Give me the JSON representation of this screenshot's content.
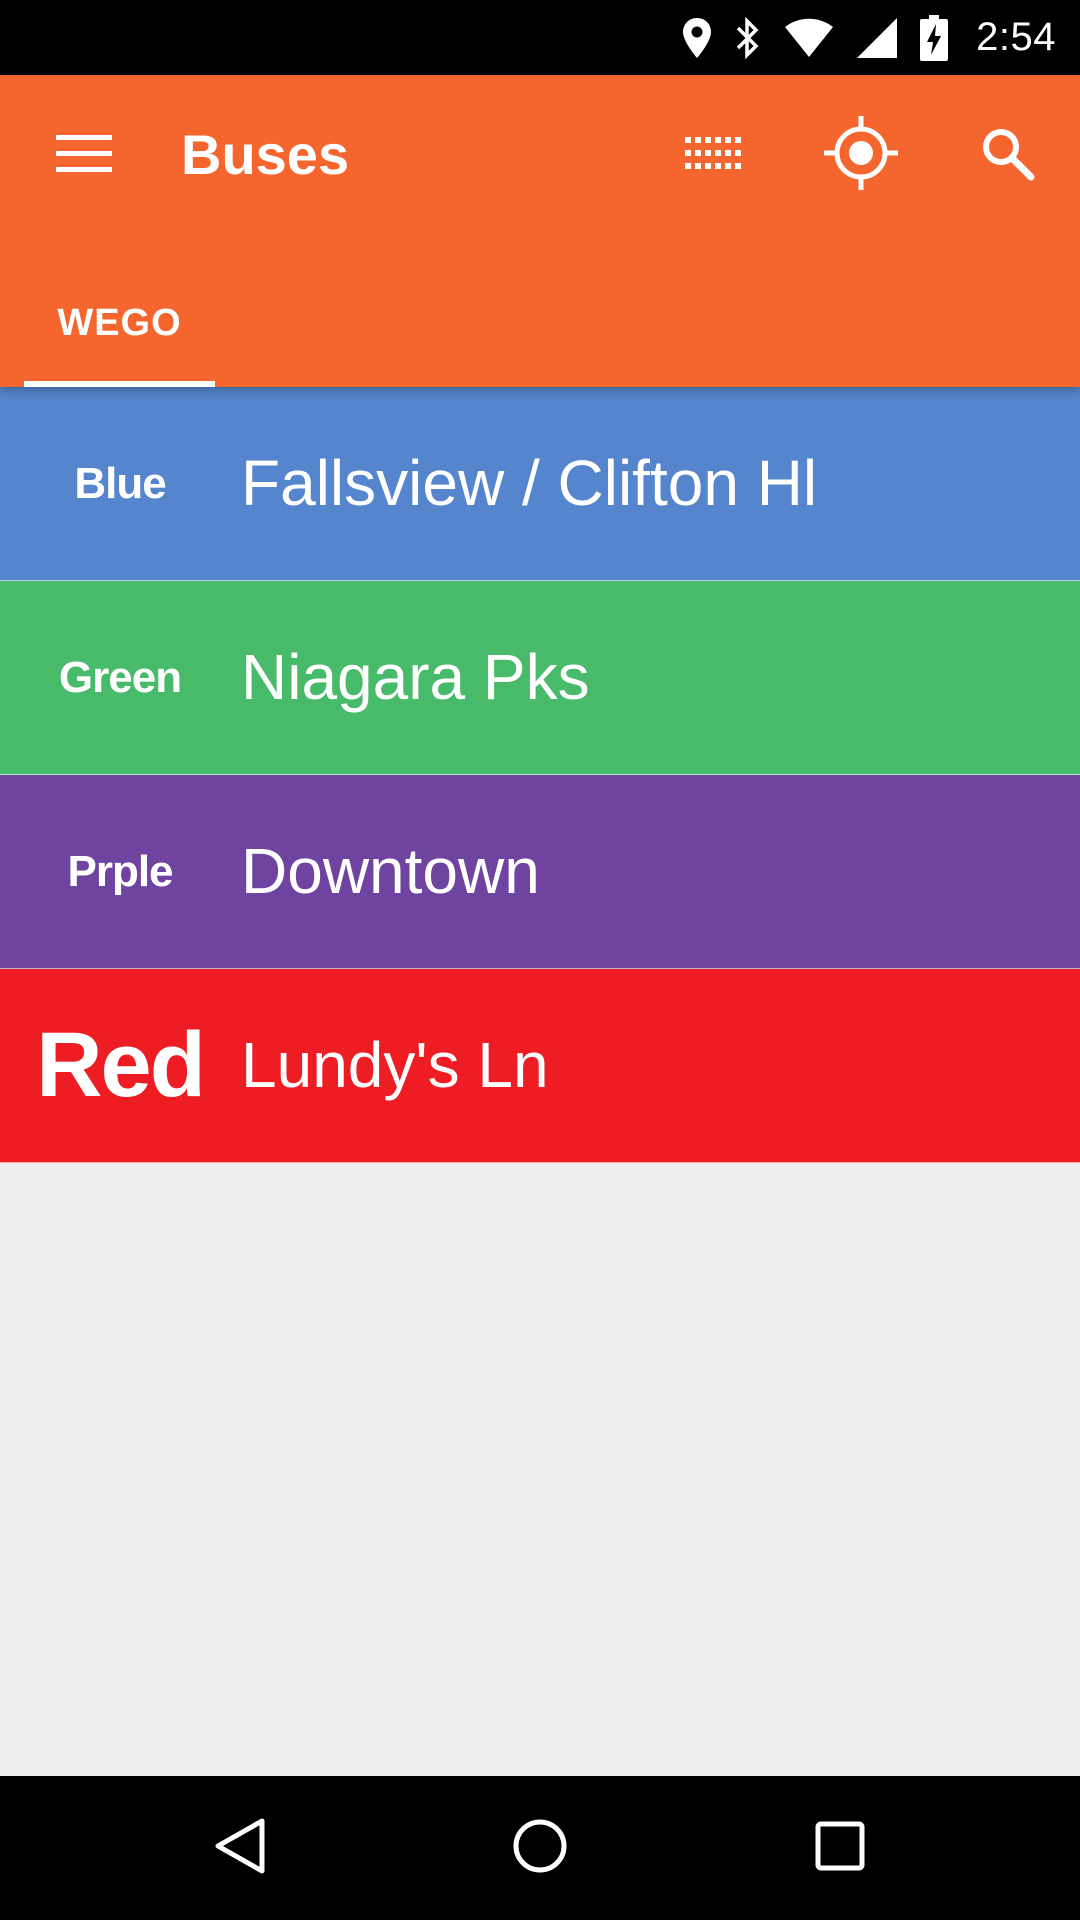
{
  "status_bar": {
    "time": "2:54",
    "icons": [
      "location-icon",
      "bluetooth-icon",
      "wifi-icon",
      "cell-signal-icon",
      "battery-charging-icon"
    ]
  },
  "app_bar": {
    "title": "Buses",
    "menu_icon": "hamburger-menu-icon",
    "actions": [
      "grid-icon",
      "my-location-icon",
      "search-icon"
    ],
    "background_color": "#f4662d"
  },
  "tabs": [
    {
      "label": "WEGO",
      "selected": true
    }
  ],
  "routes": [
    {
      "code": "Blue",
      "name": "Fallsview / Clifton Hl",
      "color": "#5585cc"
    },
    {
      "code": "Green",
      "name": "Niagara Pks",
      "color": "#47bb69"
    },
    {
      "code": "Prple",
      "name": "Downtown",
      "color": "#6f43a0"
    },
    {
      "code": "Red",
      "name": "Lundy's Ln",
      "color": "#ee1d23"
    }
  ],
  "nav_bar": {
    "buttons": [
      "back-icon",
      "home-icon",
      "recents-icon"
    ]
  }
}
